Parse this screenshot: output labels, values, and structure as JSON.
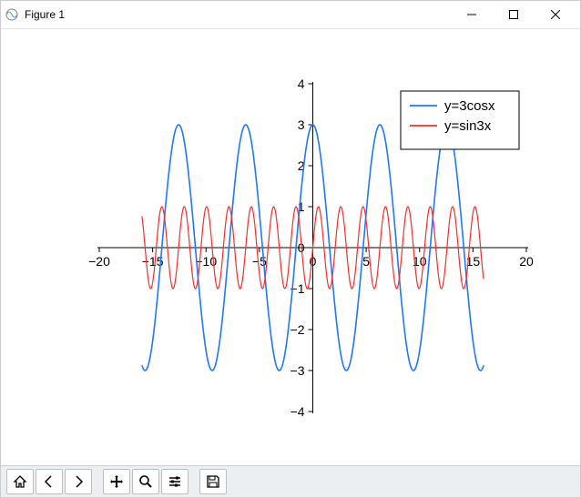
{
  "window": {
    "title": "Figure 1"
  },
  "toolbar": {
    "items": [
      {
        "name": "home-icon",
        "label": "Home"
      },
      {
        "name": "back-icon",
        "label": "Back"
      },
      {
        "name": "forward-icon",
        "label": "Forward"
      },
      {
        "name": "pan-icon",
        "label": "Pan"
      },
      {
        "name": "zoom-icon",
        "label": "Zoom"
      },
      {
        "name": "configure-icon",
        "label": "Configure subplots"
      },
      {
        "name": "save-icon",
        "label": "Save"
      }
    ]
  },
  "chart_data": {
    "type": "line",
    "title": "",
    "xlabel": "",
    "ylabel": "",
    "xlim": [
      -20,
      20
    ],
    "ylim": [
      -4,
      4
    ],
    "xticks": [
      -20,
      -15,
      -10,
      -5,
      0,
      5,
      10,
      15,
      20
    ],
    "yticks": [
      -4,
      -3,
      -2,
      -1,
      0,
      1,
      2,
      3,
      4
    ],
    "legend_position": "upper right",
    "x_domain_drawn": [
      -16,
      16
    ],
    "series": [
      {
        "name": "y=3cosx",
        "color": "#1f77ff",
        "formula": "3*cos(x)",
        "amplitude": 3,
        "angular_frequency": 1
      },
      {
        "name": "y=sin3x",
        "color": "#ff2a2a",
        "formula": "sin(3*x)",
        "amplitude": 1,
        "angular_frequency": 3
      }
    ]
  }
}
